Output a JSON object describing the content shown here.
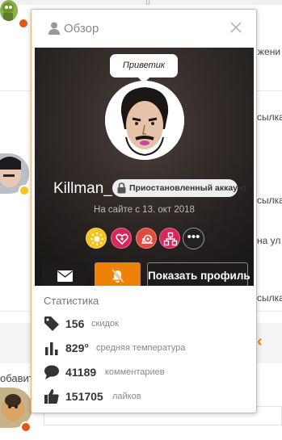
{
  "background": {
    "right_texts": [
      "жени",
      "сылка",
      "сылка",
      "на ул",
      "сылка",
      "сылка"
    ],
    "left_text": "обавит"
  },
  "popup": {
    "header_title": "Обзор",
    "status_text": "Приветик",
    "username": "Killman_",
    "suspended_label": "Приостановленный аккаунт",
    "since_text": "На сайте с 13. окт 2018",
    "more_label": "•••",
    "profile_button_label": "Показать профиль",
    "stats_title": "Статистика",
    "stats": [
      {
        "value": "156",
        "label": "скидок",
        "icon": "tag-icon"
      },
      {
        "value": "829°",
        "label": "средняя температура",
        "icon": "bar-chart-icon"
      },
      {
        "value": "41189",
        "label": "комментариев",
        "icon": "comment-icon"
      },
      {
        "value": "151705",
        "label": "лайков",
        "icon": "thumbs-up-icon"
      }
    ],
    "achievements": [
      {
        "name": "sun-badge-icon",
        "color": "#f2c61f"
      },
      {
        "name": "heart-badge-icon",
        "color": "#d6265c"
      },
      {
        "name": "snail-badge-icon",
        "color": "#e34a3e"
      },
      {
        "name": "network-badge-icon",
        "color": "#d6265c"
      }
    ]
  },
  "colors": {
    "accent": "#ee8208",
    "dark_button": "#1c1c1c"
  }
}
